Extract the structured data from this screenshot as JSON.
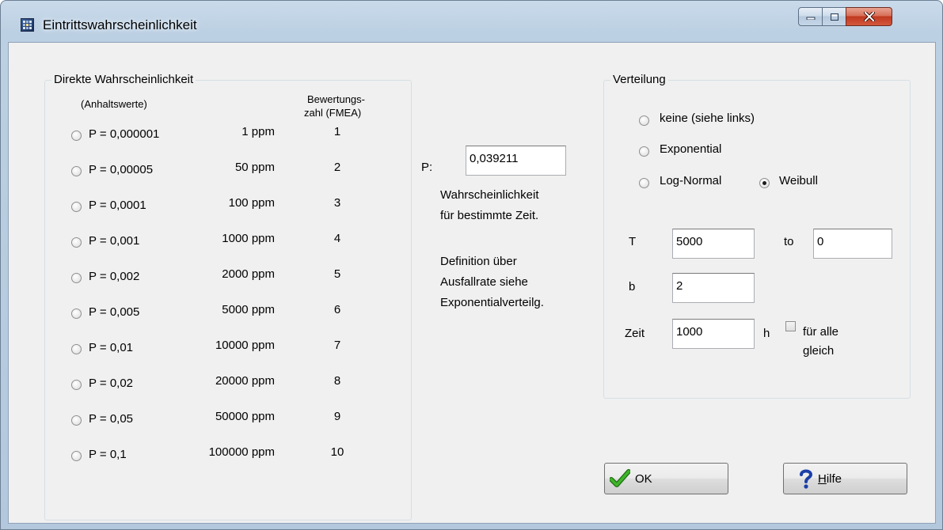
{
  "window": {
    "title": "Eintrittswahrscheinlichkeit",
    "icon": "app-grid-icon"
  },
  "caption_buttons": {
    "minimize": "minimize-icon",
    "maximize": "maximize-icon",
    "close": "close-icon"
  },
  "left_group": {
    "title": "Direkte Wahrscheinlichkeit",
    "hint": "(Anhaltswerte)",
    "score_header_1": "Bewertungs-",
    "score_header_2": "zahl (FMEA)",
    "options": [
      {
        "p": "P = 0,000001",
        "ppm": "1 ppm",
        "score": "1"
      },
      {
        "p": "P = 0,00005",
        "ppm": "50 ppm",
        "score": "2"
      },
      {
        "p": "P = 0,0001",
        "ppm": "100 ppm",
        "score": "3"
      },
      {
        "p": "P = 0,001",
        "ppm": "1000 ppm",
        "score": "4"
      },
      {
        "p": "P = 0,002",
        "ppm": "2000 ppm",
        "score": "5"
      },
      {
        "p": "P = 0,005",
        "ppm": "5000 ppm",
        "score": "6"
      },
      {
        "p": "P = 0,01",
        "ppm": "10000 ppm",
        "score": "7"
      },
      {
        "p": "P = 0,02",
        "ppm": "20000 ppm",
        "score": "8"
      },
      {
        "p": "P = 0,05",
        "ppm": "50000 ppm",
        "score": "9"
      },
      {
        "p": "P = 0,1",
        "ppm": "100000 ppm",
        "score": "10"
      }
    ]
  },
  "middle": {
    "p_label": "P:",
    "p_value": "0,039211",
    "desc_line1": "Wahrscheinlichkeit",
    "desc_line2": "für bestimmte Zeit.",
    "def_line1": "Definition über",
    "def_line2": "Ausfallrate siehe",
    "def_line3": "Exponentialverteilg."
  },
  "right_group": {
    "title": "Verteilung",
    "opt_none": "keine (siehe links)",
    "opt_exponential": "Exponential",
    "opt_lognormal": "Log-Normal",
    "opt_weibull": "Weibull",
    "selected": "Weibull",
    "t_label": "T",
    "t_value": "5000",
    "t0_label": "to",
    "t0_value": "0",
    "b_label": "b",
    "b_value": "2",
    "zeit_label": "Zeit",
    "zeit_value": "1000",
    "unit_h": "h",
    "same_for_all_line1": "für alle",
    "same_for_all_line2": "gleich",
    "same_for_all_checked": false
  },
  "buttons": {
    "ok_label": "OK",
    "ok_icon": "checkmark-icon",
    "help_label_accel": "H",
    "help_label_rest": "ilfe",
    "help_icon": "question-mark-icon"
  },
  "colors": {
    "titlebar": "#bcd0e3",
    "client_bg": "#f0f0f0",
    "close_button": "#c0391f",
    "ok_check": "#2e9a1e",
    "help_question": "#1b3fa8"
  }
}
